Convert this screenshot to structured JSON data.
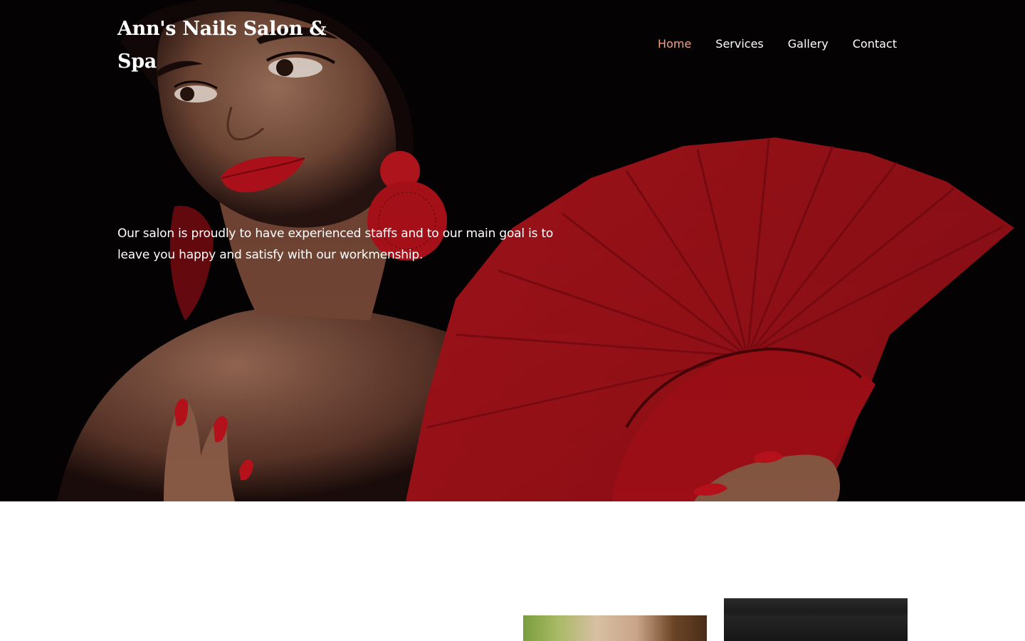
{
  "header": {
    "site_title": "Ann's Nails Salon & Spa",
    "nav": [
      {
        "label": "Home",
        "active": true
      },
      {
        "label": "Services",
        "active": false
      },
      {
        "label": "Gallery",
        "active": false
      },
      {
        "label": "Contact",
        "active": false
      }
    ]
  },
  "hero": {
    "tagline": "Our salon is proudly to have experienced staffs and to our main goal is to leave you happy and satisfy with our workmenship."
  },
  "colors": {
    "active_nav": "#f4a084",
    "hero_background": "#050203",
    "accent_red": "#c8141e"
  }
}
